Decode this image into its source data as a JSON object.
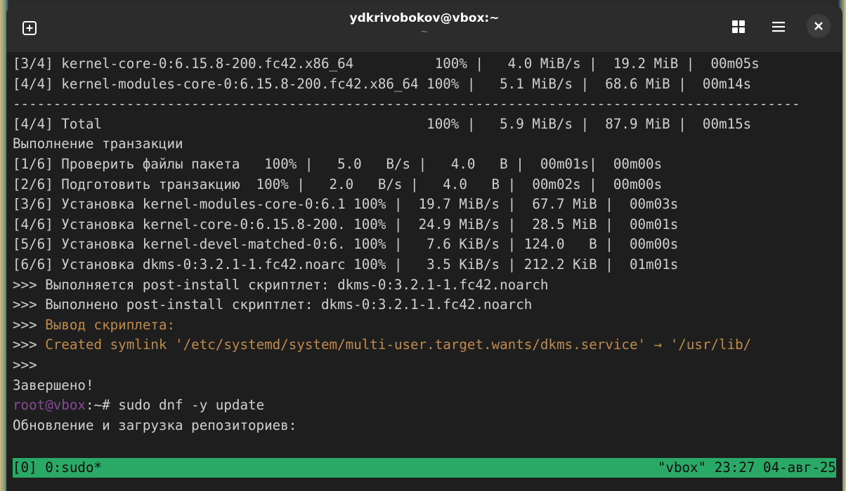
{
  "window": {
    "title": "ydkrivobokov@vbox:~",
    "subtitle": "~"
  },
  "icons": {
    "new_tab": "plus-square-icon",
    "tabs_overview": "grid-icon",
    "menu": "hamburger-menu-icon",
    "close": "close-icon"
  },
  "terminal": {
    "lines": [
      {
        "text": "[3/4] kernel-core-0:6.15.8-200.fc42.x86_64          100% |   4.0 MiB/s |  19.2 MiB |  00m05s"
      },
      {
        "text": "[4/4] kernel-modules-core-0:6.15.8-200.fc42.x86_64 100% |   5.1 MiB/s |  68.6 MiB |  00m14s"
      },
      {
        "text": "-------------------------------------------------------------------------------------------------"
      },
      {
        "text": "[4/4] Total                                        100% |   5.9 MiB/s |  87.9 MiB |  00m15s"
      },
      {
        "text": "Выполнение транзакции"
      },
      {
        "text": "[1/6] Проверить файлы пакета   100% |   5.0   B/s |   4.0   B |  00m01s|  00m00s"
      },
      {
        "text": "[2/6] Подготовить транзакцию  100% |   2.0   B/s |   4.0   B |  00m02s |  00m00s"
      },
      {
        "text": "[3/6] Установка kernel-modules-core-0:6.1 100% |  19.7 MiB/s |  67.7 MiB |  00m03s"
      },
      {
        "text": "[4/6] Установка kernel-core-0:6.15.8-200. 100% |  24.9 MiB/s |  28.5 MiB |  00m01s"
      },
      {
        "text": "[5/6] Установка kernel-devel-matched-0:6. 100% |   7.6 KiB/s | 124.0   B |  00m00s"
      },
      {
        "text": "[6/6] Установка dkms-0:3.2.1-1.fc42.noarc 100% |   3.5 KiB/s | 212.2 KiB |  01m01s"
      },
      {
        "text": ">>> Выполняется post-install скриптлет: dkms-0:3.2.1-1.fc42.noarch"
      },
      {
        "text": ">>> Выполнено post-install скриптлет: dkms-0:3.2.1-1.fc42.noarch"
      },
      {
        "prefix": ">>> ",
        "rest": "Вывод скриплета:"
      },
      {
        "prefix": ">>> ",
        "rest": "Created symlink '/etc/systemd/system/multi-user.target.wants/dkms.service' → '/usr/lib/"
      },
      {
        "text": ">>>"
      },
      {
        "text": "Завершено!"
      },
      {
        "user": "root@vbox",
        "path": ":~",
        "prompt": "# ",
        "cmd": "sudo dnf -y update"
      },
      {
        "text": "Обновление и загрузка репозиториев:"
      }
    ]
  },
  "status": {
    "left": "[0] 0:sudo*",
    "right": "\"vbox\" 23:27 04-авг-25"
  },
  "colors": {
    "status_bg": "#2aa866",
    "script_output": "#c08a4a",
    "prompt_user": "#8a4a9a"
  }
}
